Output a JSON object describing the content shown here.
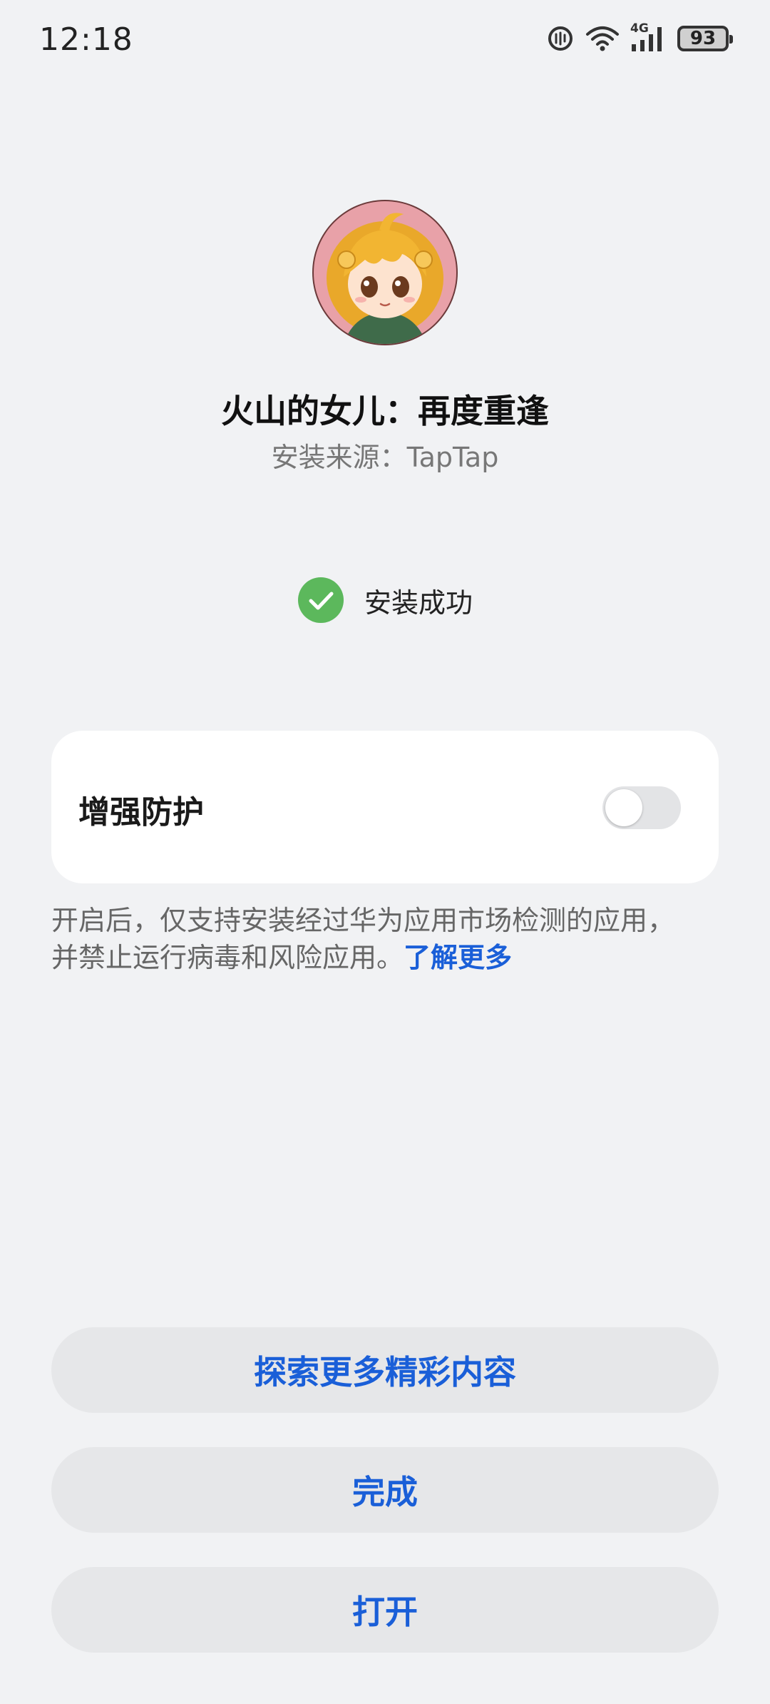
{
  "status_bar": {
    "time": "12:18",
    "network": "4G",
    "battery": "93"
  },
  "app": {
    "name": "火山的女儿：再度重逢",
    "source": "安装来源：TapTap"
  },
  "status": {
    "message": "安装成功",
    "icon": "check-circle-icon",
    "color": "#5cb85c"
  },
  "protection": {
    "label": "增强防护",
    "enabled": false,
    "note": "开启后，仅支持安装经过华为应用市场检测的应用，并禁止运行病毒和风险应用。",
    "link": "了解更多"
  },
  "buttons": {
    "explore": "探索更多精彩内容",
    "done": "完成",
    "open": "打开"
  },
  "colors": {
    "accent": "#1a5fd8",
    "background": "#f1f2f4"
  }
}
